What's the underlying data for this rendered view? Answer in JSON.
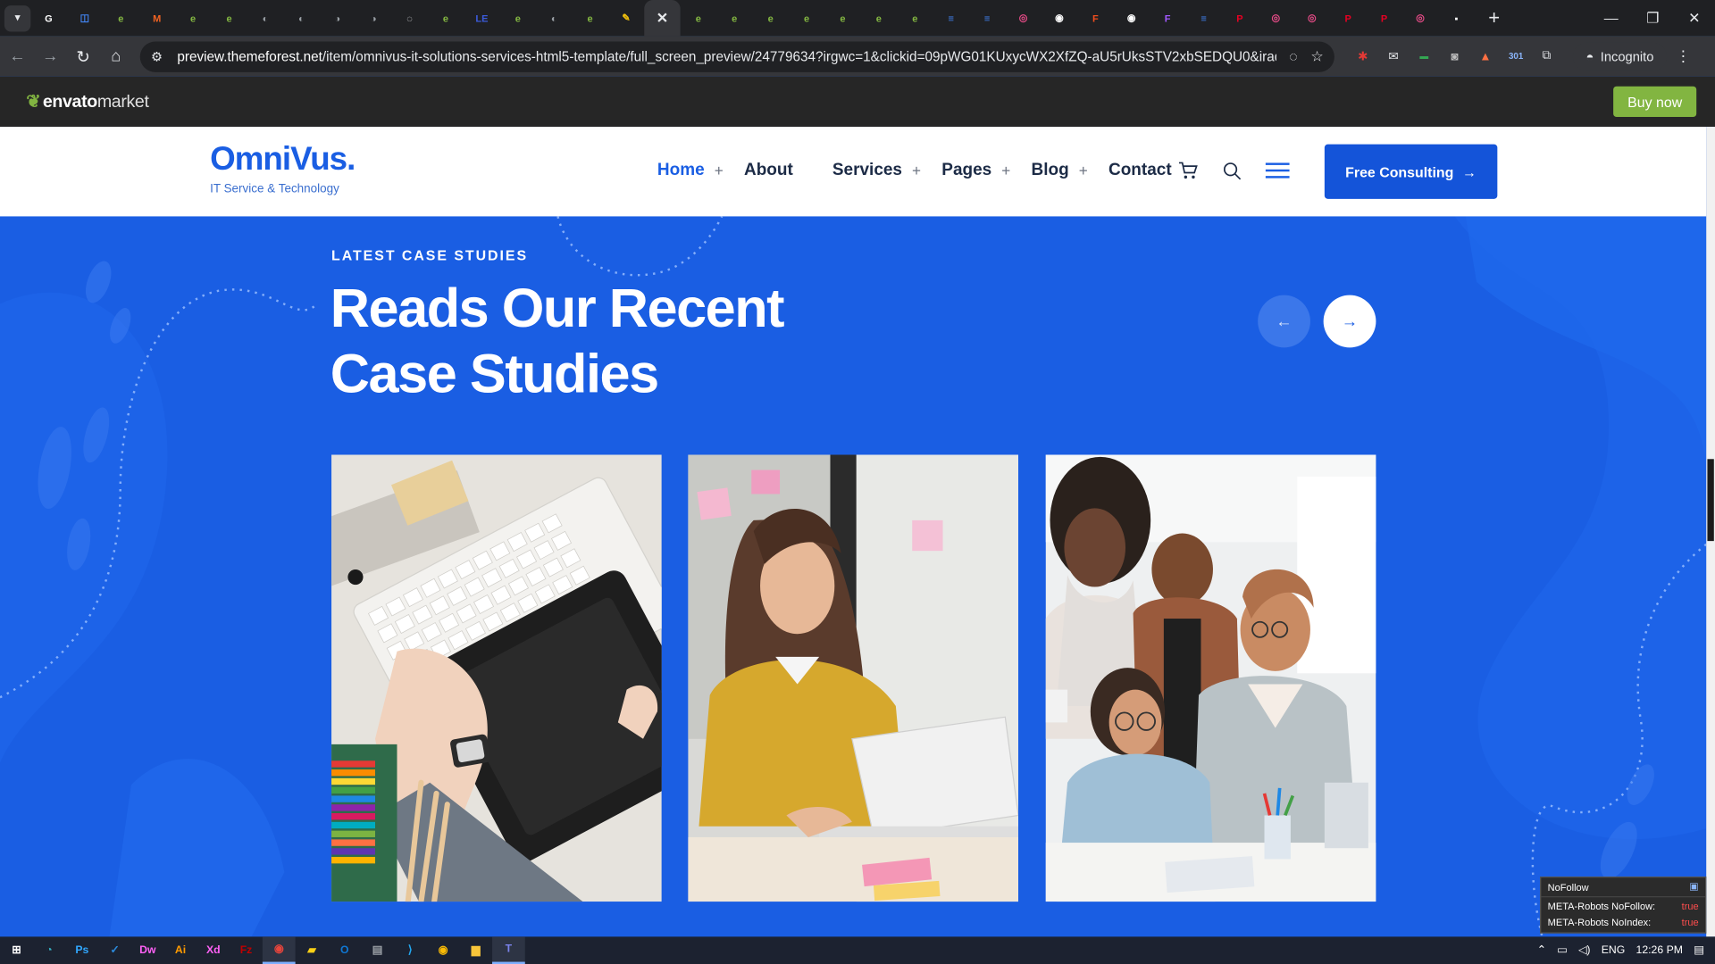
{
  "browser": {
    "active_tab_close": "✕",
    "new_tab": "+",
    "tabs_count_note": "",
    "tab_favicons": [
      {
        "icon": "google-icon",
        "color": "#ffffff",
        "glyph": "G"
      },
      {
        "icon": "instagram-icon",
        "color": "#4285f4",
        "glyph": "◫"
      },
      {
        "icon": "envato-icon",
        "color": "#82b541",
        "glyph": "e"
      },
      {
        "icon": "magento-icon",
        "color": "#f26322",
        "glyph": "M"
      },
      {
        "icon": "envato-icon",
        "color": "#82b541",
        "glyph": "e"
      },
      {
        "icon": "envato-icon",
        "color": "#82b541",
        "glyph": "e"
      },
      {
        "icon": "globe-icon",
        "color": "#9aa0a6",
        "glyph": "◐"
      },
      {
        "icon": "globe-icon",
        "color": "#9aa0a6",
        "glyph": "◐"
      },
      {
        "icon": "globe-icon",
        "color": "#9aa0a6",
        "glyph": "◑"
      },
      {
        "icon": "globe-icon",
        "color": "#9aa0a6",
        "glyph": "◑"
      },
      {
        "icon": "spinner-icon",
        "color": "#e8eaed",
        "glyph": "◌"
      },
      {
        "icon": "envato-icon",
        "color": "#82b541",
        "glyph": "e"
      },
      {
        "icon": "le-icon",
        "color": "#3b5bdb",
        "glyph": "LE"
      },
      {
        "icon": "envato-icon",
        "color": "#82b541",
        "glyph": "e"
      },
      {
        "icon": "globe-icon",
        "color": "#9aa0a6",
        "glyph": "◐"
      },
      {
        "icon": "envato-icon",
        "color": "#82b541",
        "glyph": "e"
      },
      {
        "icon": "wrench-icon",
        "color": "#f4c20d",
        "glyph": "✎"
      }
    ],
    "tab_favicons_after": [
      {
        "icon": "envato-icon",
        "color": "#82b541",
        "glyph": "e"
      },
      {
        "icon": "envato-icon",
        "color": "#82b541",
        "glyph": "e"
      },
      {
        "icon": "envato-icon",
        "color": "#82b541",
        "glyph": "e"
      },
      {
        "icon": "envato-icon",
        "color": "#82b541",
        "glyph": "e"
      },
      {
        "icon": "envato-icon",
        "color": "#82b541",
        "glyph": "e"
      },
      {
        "icon": "envato-icon",
        "color": "#82b541",
        "glyph": "e"
      },
      {
        "icon": "envato-icon",
        "color": "#82b541",
        "glyph": "e"
      },
      {
        "icon": "docs-icon",
        "color": "#4285f4",
        "glyph": "≡"
      },
      {
        "icon": "forms-icon",
        "color": "#4285f4",
        "glyph": "≡"
      },
      {
        "icon": "dribbble-icon",
        "color": "#ea4c89",
        "glyph": "◎"
      },
      {
        "icon": "chrome-icon",
        "color": "#ffffff",
        "glyph": "◉"
      },
      {
        "icon": "figma-icon",
        "color": "#f24e1e",
        "glyph": "F"
      },
      {
        "icon": "chrome-icon",
        "color": "#ffffff",
        "glyph": "◉"
      },
      {
        "icon": "figma-icon",
        "color": "#a259ff",
        "glyph": "F"
      },
      {
        "icon": "forms-icon",
        "color": "#4285f4",
        "glyph": "≡"
      },
      {
        "icon": "pinterest-icon",
        "color": "#e60023",
        "glyph": "P"
      },
      {
        "icon": "dribbble-icon",
        "color": "#ea4c89",
        "glyph": "◎"
      },
      {
        "icon": "dribbble-icon",
        "color": "#ea4c89",
        "glyph": "◎"
      },
      {
        "icon": "pinterest-icon",
        "color": "#e60023",
        "glyph": "P"
      },
      {
        "icon": "pinterest-icon",
        "color": "#e60023",
        "glyph": "P"
      },
      {
        "icon": "dribbble-icon",
        "color": "#ea4c89",
        "glyph": "◎"
      },
      {
        "icon": "app-icon",
        "color": "#ffffff",
        "glyph": "▪"
      }
    ],
    "url_host": "preview.themeforest.net",
    "url_path": "/item/omnivus-it-solutions-services-html5-template/full_screen_preview/24779634?irgwc=1&clickid=09pWG01KUxycWX2XfZQ-aU5rUksSTV2xbSEDQU0&iradid=475676&ir...",
    "incognito_label": "Incognito",
    "extension_badge": "301"
  },
  "envato": {
    "logo_word": "envato",
    "logo_suffix": "market",
    "buy_label": "Buy now"
  },
  "site": {
    "brand_name": "OmniVus.",
    "brand_tagline": "IT Service & Technology",
    "nav": [
      {
        "label": "Home",
        "has_plus": true
      },
      {
        "label": "About",
        "has_plus": false
      },
      {
        "label": "Services",
        "has_plus": true
      },
      {
        "label": "Pages",
        "has_plus": true
      },
      {
        "label": "Blog",
        "has_plus": true
      },
      {
        "label": "Contact",
        "has_plus": false
      }
    ],
    "plus": "+",
    "cta_label": "Free Consulting",
    "cta_arrow": "→"
  },
  "hero": {
    "eyebrow": "LATEST CASE STUDIES",
    "title_line1": "Reads Our Recent",
    "title_line2": "Case Studies",
    "prev_arrow": "←",
    "next_arrow": "→",
    "cards": [
      {
        "name": "case-study-card-designer-keyboard"
      },
      {
        "name": "case-study-card-woman-laptop"
      },
      {
        "name": "case-study-card-team-meeting"
      }
    ]
  },
  "seo_widget": {
    "title": "NoFollow",
    "row1_label": "META-Robots NoFollow:",
    "row1_value": "true",
    "row2_label": "META-Robots NoIndex:",
    "row2_value": "true"
  },
  "taskbar": {
    "apps": [
      {
        "icon": "windows-start-icon",
        "glyph": "⊞",
        "color": "#ffffff"
      },
      {
        "icon": "edge-icon",
        "glyph": "◔",
        "color": "#36b3c4"
      },
      {
        "icon": "photoshop-icon",
        "glyph": "Ps",
        "color": "#31a8ff"
      },
      {
        "icon": "todo-icon",
        "glyph": "✓",
        "color": "#2b88d8"
      },
      {
        "icon": "dreamweaver-icon",
        "glyph": "Dw",
        "color": "#ff61f6"
      },
      {
        "icon": "illustrator-icon",
        "glyph": "Ai",
        "color": "#ff9a00"
      },
      {
        "icon": "xd-icon",
        "glyph": "Xd",
        "color": "#ff61f6"
      },
      {
        "icon": "filezilla-icon",
        "glyph": "Fz",
        "color": "#bf0000"
      },
      {
        "icon": "chrome-icon",
        "glyph": "◉",
        "color": "#e8453c"
      },
      {
        "icon": "sticky-notes-icon",
        "glyph": "▰",
        "color": "#fcd116"
      },
      {
        "icon": "outlook-icon",
        "glyph": "O",
        "color": "#0f78d4"
      },
      {
        "icon": "notepad-icon",
        "glyph": "▤",
        "color": "#9aa0a6"
      },
      {
        "icon": "vscode-icon",
        "glyph": "⟩",
        "color": "#23a9f2"
      },
      {
        "icon": "chrome-icon",
        "glyph": "◉",
        "color": "#fbbc05"
      },
      {
        "icon": "file-explorer-icon",
        "glyph": "▆",
        "color": "#f8c53a"
      },
      {
        "icon": "teams-icon",
        "glyph": "T",
        "color": "#7b83eb"
      }
    ],
    "language": "ENG",
    "clock": "12:26 PM"
  }
}
